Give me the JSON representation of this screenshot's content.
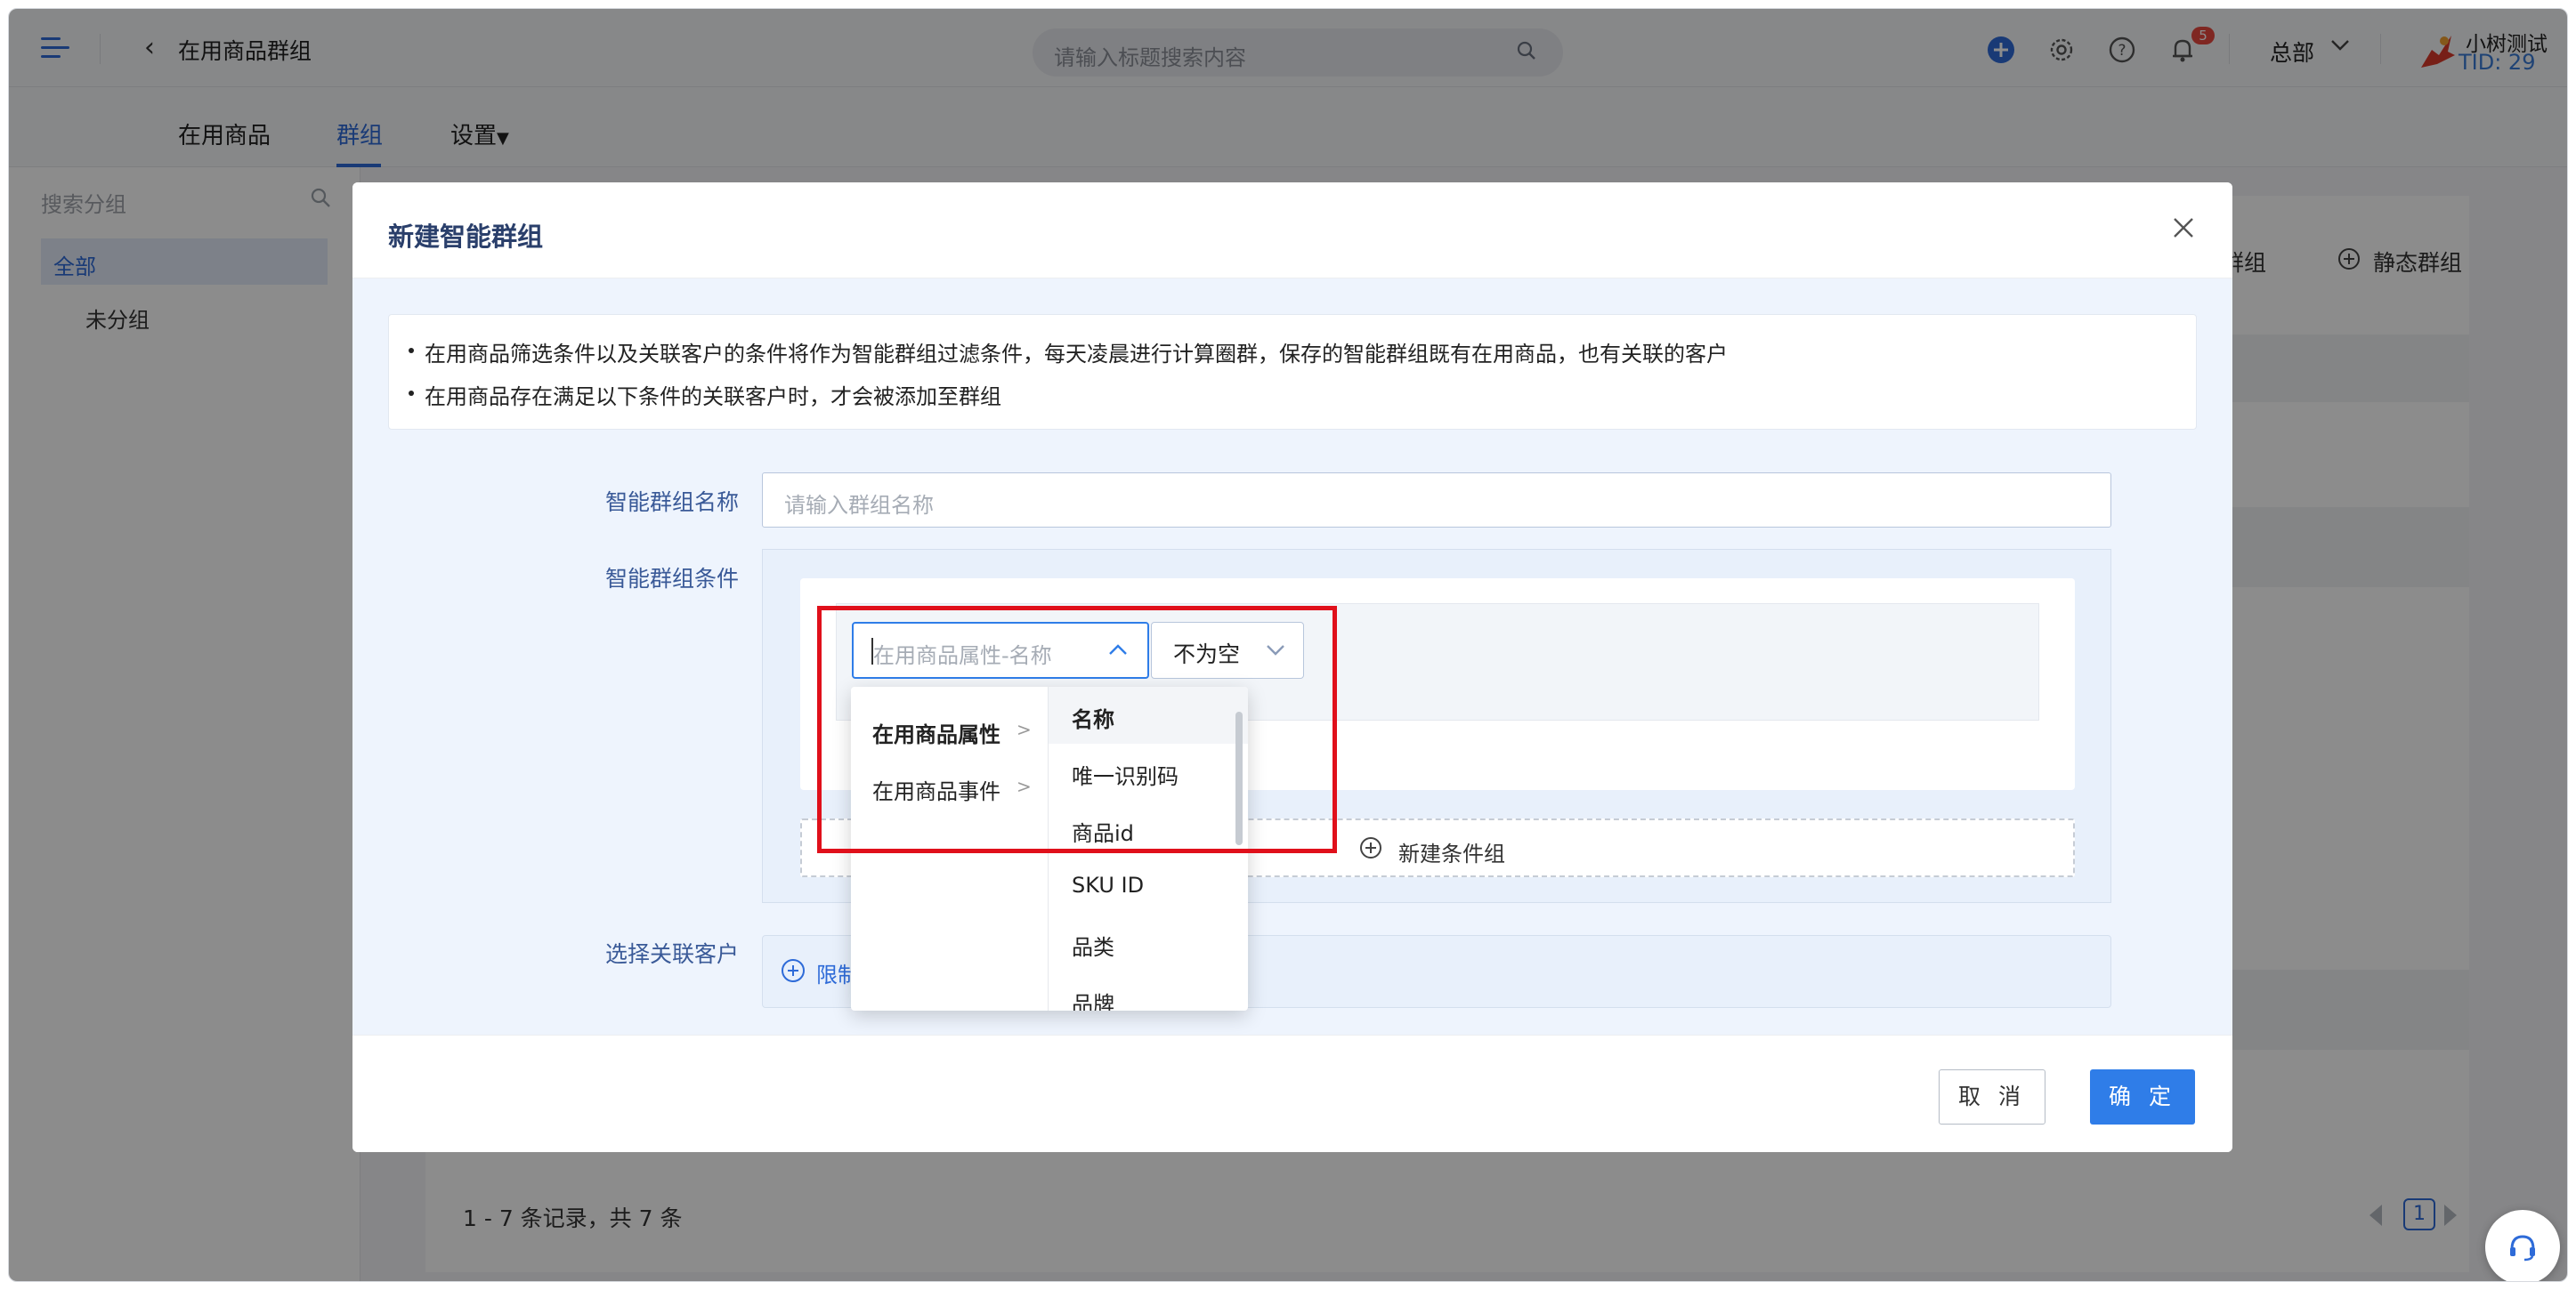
{
  "topbar": {
    "page_title": "在用商品群组",
    "search_placeholder": "请输入标题搜索内容",
    "notification_count": "5",
    "org": "总部",
    "user_name": "小树测试",
    "user_tid": "TID: 29"
  },
  "nav": {
    "tabs": [
      "在用商品",
      "群组",
      "设置"
    ],
    "active_tab": "群组"
  },
  "sidebar": {
    "search_placeholder": "搜索分组",
    "items": [
      "全部",
      "未分组"
    ]
  },
  "background": {
    "header_buttons": [
      "群组",
      "静态群组"
    ],
    "records_text": "1 - 7 条记录，共 7 条",
    "page": "1"
  },
  "modal": {
    "title": "新建智能群组",
    "notices": [
      "在用商品筛选条件以及关联客户的条件将作为智能群组过滤条件，每天凌晨进行计算圈群，保存的智能群组既有在用商品，也有关联的客户",
      "在用商品存在满足以下条件的关联客户时，才会被添加至群组"
    ],
    "labels": {
      "name": "智能群组名称",
      "condition": "智能群组条件",
      "customer": "选择关联客户"
    },
    "name_placeholder": "请输入群组名称",
    "attr_placeholder": "在用商品属性-名称",
    "operator": "不为空",
    "new_group": "新建条件组",
    "customer_link": "限制",
    "cancel": "取 消",
    "ok": "确 定",
    "cascader": {
      "left": [
        "在用商品属性",
        "在用商品事件"
      ],
      "right": [
        "名称",
        "唯一识别码",
        "商品id",
        "SKU ID",
        "品类",
        "品牌"
      ],
      "selected": "名称"
    }
  },
  "colors": {
    "accent": "#2f7de8",
    "highlight": "#e0101b",
    "badge": "#e8473e"
  }
}
